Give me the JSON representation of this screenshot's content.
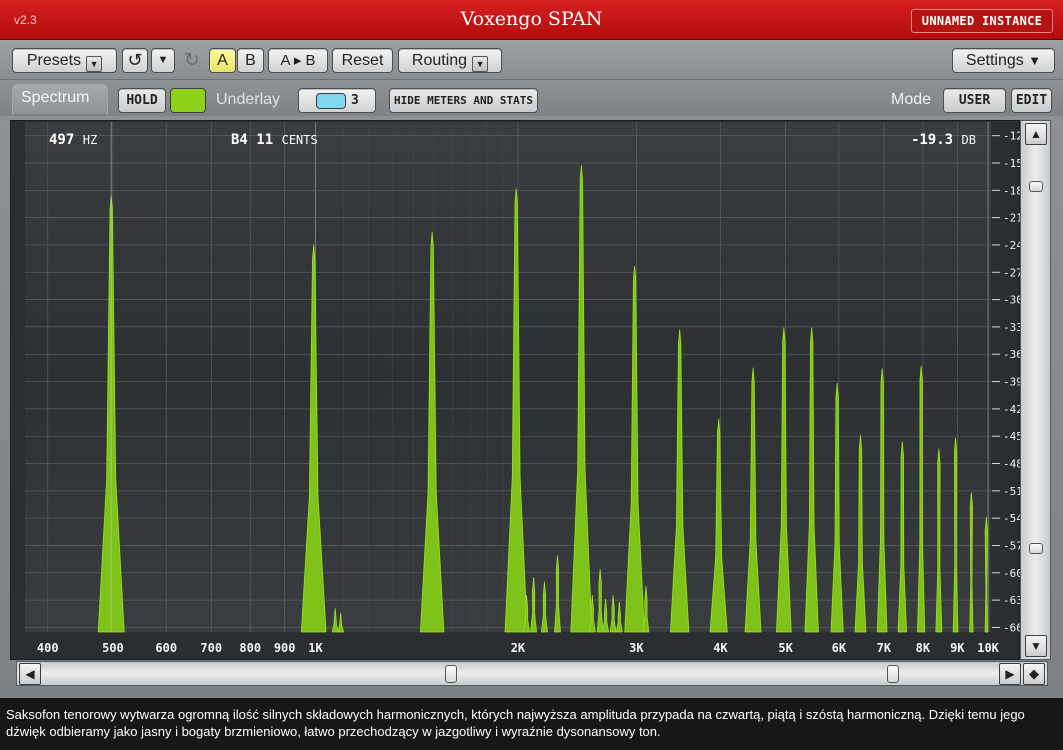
{
  "window": {
    "version": "v2.3",
    "title": "Voxengo SPAN",
    "instance_label": "UNNAMED INSTANCE"
  },
  "toolbar": {
    "presets": "Presets",
    "dropdown_glyph": "▼",
    "undo_glyph": "↺",
    "redo_glyph": "↻",
    "a": "A",
    "b": "B",
    "ab_copy": "A ▸ B",
    "reset": "Reset",
    "routing": "Routing",
    "settings": "Settings"
  },
  "controls": {
    "spectrum_tab": "Spectrum",
    "hold": "HOLD",
    "hold_color": "#8fd11a",
    "underlay": "Underlay",
    "underlay_color": "#7fd6ef",
    "underlay_value": "3",
    "hide_meters": "HIDE METERS AND STATS",
    "mode_label": "Mode",
    "mode_value": "USER",
    "edit": "EDIT"
  },
  "readout": {
    "freq_value": "497",
    "freq_unit": "HZ",
    "note": "B4",
    "cents_value": "11",
    "cents_unit": "CENTS",
    "level_value": "-19.3",
    "level_unit": "DB"
  },
  "axes": {
    "x_ticks": [
      {
        "label": "400",
        "f": 400
      },
      {
        "label": "500",
        "f": 500
      },
      {
        "label": "600",
        "f": 600
      },
      {
        "label": "700",
        "f": 700
      },
      {
        "label": "800",
        "f": 800
      },
      {
        "label": "900",
        "f": 900
      },
      {
        "label": "1K",
        "f": 1000
      },
      {
        "label": "2K",
        "f": 2000
      },
      {
        "label": "3K",
        "f": 3000
      },
      {
        "label": "4K",
        "f": 4000
      },
      {
        "label": "5K",
        "f": 5000
      },
      {
        "label": "6K",
        "f": 6000
      },
      {
        "label": "7K",
        "f": 7000
      },
      {
        "label": "8K",
        "f": 8000
      },
      {
        "label": "9K",
        "f": 9000
      },
      {
        "label": "10K",
        "f": 10000
      }
    ],
    "x_range_hz": [
      370,
      10100
    ],
    "y_ticks": [
      -12,
      -15,
      -18,
      -21,
      -24,
      -27,
      -30,
      -33,
      -36,
      -39,
      -42,
      -45,
      -48,
      -51,
      -54,
      -57,
      -60,
      -63,
      -66
    ],
    "y_range_db": [
      -10.5,
      -66.5
    ],
    "grid": true
  },
  "spectrum": {
    "line_color": "#9be21f",
    "fill_color": "#7fc21a",
    "floor_db": -66.5,
    "peaks": [
      {
        "f": 497,
        "db": -18.6
      },
      {
        "f": 994,
        "db": -24.0
      },
      {
        "f": 1491,
        "db": -22.6
      },
      {
        "f": 1988,
        "db": -17.8
      },
      {
        "f": 2485,
        "db": -15.3
      },
      {
        "f": 2982,
        "db": -26.3
      },
      {
        "f": 3479,
        "db": -33.3
      },
      {
        "f": 3976,
        "db": -43.1
      },
      {
        "f": 4473,
        "db": -37.5
      },
      {
        "f": 4970,
        "db": -33.1
      },
      {
        "f": 5467,
        "db": -33.1
      },
      {
        "f": 5964,
        "db": -39.2
      },
      {
        "f": 6461,
        "db": -44.9
      },
      {
        "f": 6958,
        "db": -37.6
      },
      {
        "f": 7455,
        "db": -45.6
      },
      {
        "f": 7952,
        "db": -37.3
      },
      {
        "f": 8449,
        "db": -46.4
      },
      {
        "f": 8946,
        "db": -45.2
      },
      {
        "f": 9443,
        "db": -51.2
      },
      {
        "f": 9940,
        "db": -53.9
      }
    ],
    "small_peaks": [
      {
        "f": 1070,
        "db": -63.9
      },
      {
        "f": 1090,
        "db": -64.4
      },
      {
        "f": 2060,
        "db": -62.5
      },
      {
        "f": 2110,
        "db": -60.5
      },
      {
        "f": 2190,
        "db": -61.0
      },
      {
        "f": 2290,
        "db": -58.1
      },
      {
        "f": 2580,
        "db": -62.5
      },
      {
        "f": 2650,
        "db": -59.6
      },
      {
        "f": 2700,
        "db": -62.9
      },
      {
        "f": 2770,
        "db": -62.5
      },
      {
        "f": 2830,
        "db": -63.2
      },
      {
        "f": 3100,
        "db": -61.5
      }
    ]
  },
  "caption": "Saksofon tenorowy wytwarza ogromną ilość silnych składowych harmonicznych, których najwyższa amplituda przypada na czwartą, piątą i szóstą harmoniczną. Dzięki temu jego dźwięk odbieramy jako jasny i bogaty brzmieniowo, łatwo przechodzący w jazgotliwy i wyraźnie dysonansowy ton."
}
